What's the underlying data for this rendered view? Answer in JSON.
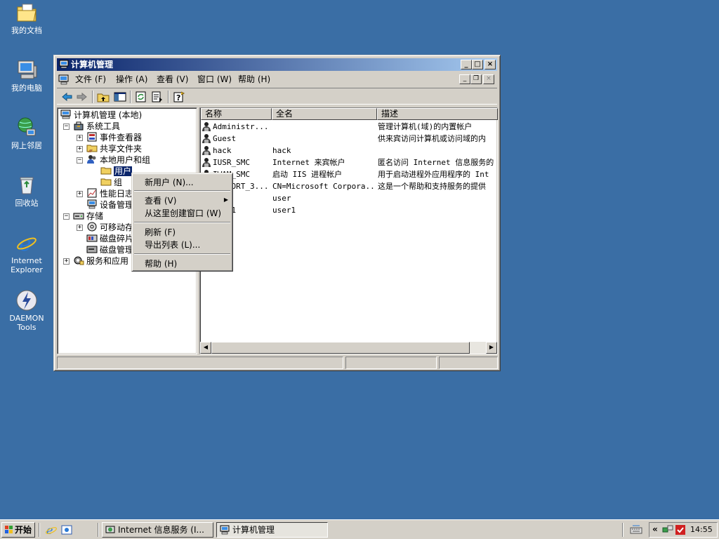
{
  "desktop": {
    "icons": [
      {
        "label": "我的文档",
        "icon": "my-documents-icon"
      },
      {
        "label": "我的电脑",
        "icon": "my-computer-icon"
      },
      {
        "label": "网上邻居",
        "icon": "network-places-icon"
      },
      {
        "label": "回收站",
        "icon": "recycle-bin-icon"
      },
      {
        "label": "Internet Explorer",
        "icon": "internet-explorer-icon"
      },
      {
        "label": "DAEMON Tools",
        "icon": "daemon-tools-icon"
      }
    ]
  },
  "window": {
    "title": "计算机管理",
    "menu": [
      "文件 (F)",
      "操作 (A)",
      "查看 (V)",
      "窗口 (W)",
      "帮助 (H)"
    ]
  },
  "tree": {
    "root": "计算机管理 (本地)",
    "system_tools": "系统工具",
    "event_viewer": "事件查看器",
    "shared_folders": "共享文件夹",
    "local_users_groups": "本地用户和组",
    "users": "用户",
    "groups": "组",
    "perf_logs": "性能日志",
    "device_manager": "设备管理",
    "storage": "存储",
    "removable": "可移动存",
    "defrag": "磁盘碎片",
    "disk_mgmt": "磁盘管理",
    "services_apps": "服务和应用"
  },
  "list": {
    "columns": [
      "名称",
      "全名",
      "描述"
    ],
    "rows": [
      {
        "name": "Administr...",
        "full": "",
        "desc": "管理计算机(域)的内置帐户"
      },
      {
        "name": "Guest",
        "full": "",
        "desc": "供来宾访问计算机或访问域的内"
      },
      {
        "name": "hack",
        "full": "hack",
        "desc": ""
      },
      {
        "name": "IUSR_SMC",
        "full": "Internet 来宾帐户",
        "desc": "匿名访问 Internet 信息服务的"
      },
      {
        "name": "IWAM_SMC",
        "full": "启动 IIS 进程帐户",
        "desc": "用于启动进程外应用程序的 Int"
      },
      {
        "name": "SUPPORT_3...",
        "full": "CN=Microsoft Corpora...",
        "desc": "这是一个帮助和支持服务的提供"
      },
      {
        "name": "user",
        "full": "user",
        "desc": ""
      },
      {
        "name": "user1",
        "full": "user1",
        "desc": ""
      }
    ]
  },
  "context_menu": {
    "new_user": "新用户 (N)...",
    "view": "查看 (V)",
    "new_window": "从这里创建窗口 (W)",
    "refresh": "刷新 (F)",
    "export": "导出列表 (L)...",
    "help": "帮助 (H)"
  },
  "taskbar": {
    "start": "开始",
    "tasks": [
      "Internet 信息服务 (I...",
      "计算机管理"
    ],
    "clock": "14:55"
  },
  "colors": {
    "desktop": "#3a6ea5",
    "title_active": "#0a246a",
    "face": "#d4d0c8"
  }
}
